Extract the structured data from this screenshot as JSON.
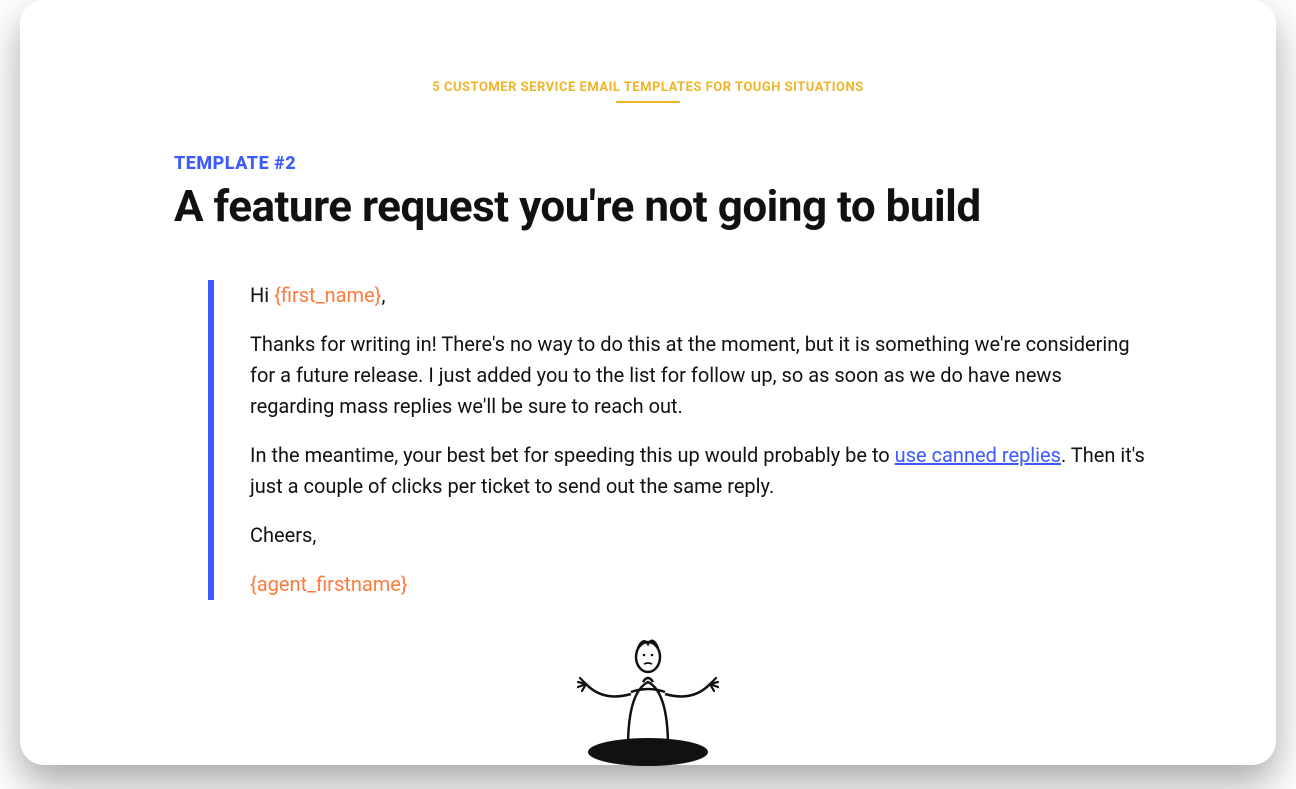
{
  "header": {
    "doc_title": "5 CUSTOMER SERVICE EMAIL TEMPLATES FOR TOUGH SITUATIONS"
  },
  "template": {
    "eyebrow": "TEMPLATE #2",
    "title": "A feature request you're not going to build",
    "greeting_prefix": "Hi ",
    "greeting_placeholder": "{first_name}",
    "greeting_suffix": ",",
    "para1": "Thanks for writing in! There's no way to do this at the moment, but it is something we're considering for a future release. I just added you to the list for follow up, so as soon as we do have news regarding mass replies we'll be sure to reach out.",
    "para2_prefix": "In the meantime, your best bet for speeding this up would probably be to ",
    "para2_link": "use canned replies",
    "para2_suffix": ". Then it's just a couple of clicks per ticket to send out the same reply.",
    "signoff": "Cheers,",
    "agent_placeholder": "{agent_firstname}"
  }
}
